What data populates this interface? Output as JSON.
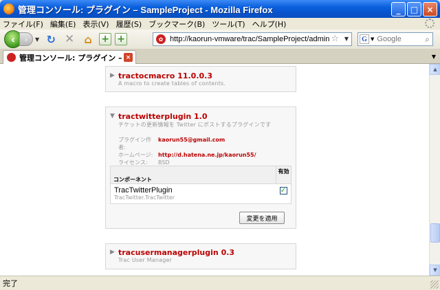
{
  "window": {
    "title": "管理コンソール: プラグイン – SampleProject - Mozilla Firefox",
    "controls": {
      "minimize": "_",
      "maximize": "□",
      "close": "×"
    }
  },
  "menubar": {
    "items": [
      "ファイル(F)",
      "編集(E)",
      "表示(V)",
      "履歴(S)",
      "ブックマーク(B)",
      "ツール(T)",
      "ヘルプ(H)"
    ]
  },
  "toolbar": {
    "back_glyph": "‹",
    "forward_glyph": "›",
    "dropdown_glyph": "▼",
    "reload_glyph": "↻",
    "stop_glyph": "✕",
    "home_glyph": "⌂",
    "bookmark_glyph": "+",
    "url": "http://kaorun-vmware/trac/SampleProject/admin/ger",
    "search_placeholder": "Google",
    "search_engine_letter": "G"
  },
  "tabs": [
    {
      "label": "管理コンソール: プラグイン – Sa...",
      "close": "×"
    }
  ],
  "plugins": [
    {
      "name": "tractocmacro 11.0.0.3",
      "description": "A macro to create tables of contents.",
      "expanded": false
    },
    {
      "name": "tractwitterplugin 1.0",
      "description": "チケットの更新情報を Twitter にポストするプラグインです",
      "expanded": true,
      "meta": [
        {
          "label": "プラグイン作者:",
          "value": "kaorun55@gmail.com"
        },
        {
          "label": "ホームページ:",
          "value": "http://d.hatena.ne.jp/kaorun55/"
        },
        {
          "label": "ライセンス:",
          "value": "BSD"
        }
      ],
      "table": {
        "col_component": "コンポーネント",
        "col_enabled": "有効",
        "rows": [
          {
            "name": "TracTwitterPlugin",
            "module": "TracTwitter.TracTwitter",
            "enabled": true,
            "check": "✓"
          }
        ]
      },
      "apply_label": "変更を適用"
    },
    {
      "name": "tracusermanagerplugin 0.3",
      "description": "Trac User Manager",
      "expanded": false
    }
  ],
  "status": "完了",
  "colors": {
    "plugin_name": "#bb0000",
    "titlebar": "#0a5fdc",
    "check": "#21a121"
  }
}
